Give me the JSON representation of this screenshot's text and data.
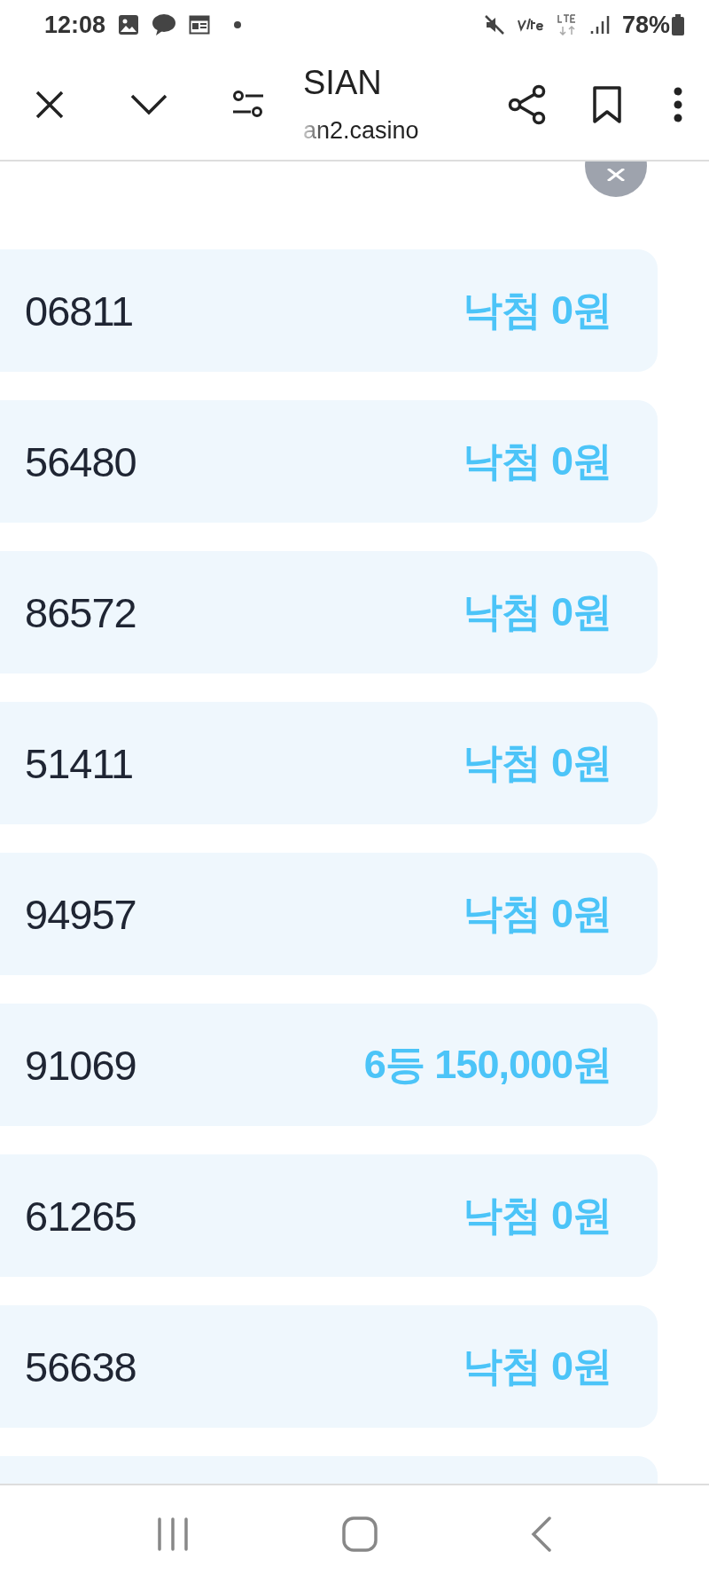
{
  "status_bar": {
    "time": "12:08",
    "battery": "78%"
  },
  "toolbar": {
    "title": "SIAN",
    "url": "an2.casino"
  },
  "rows": [
    {
      "number": "06811",
      "result": "낙첨 0원"
    },
    {
      "number": "56480",
      "result": "낙첨 0원"
    },
    {
      "number": "86572",
      "result": "낙첨 0원"
    },
    {
      "number": "51411",
      "result": "낙첨 0원"
    },
    {
      "number": "94957",
      "result": "낙첨 0원"
    },
    {
      "number": "91069",
      "result": "6등 150,000원"
    },
    {
      "number": "61265",
      "result": "낙첨 0원"
    },
    {
      "number": "56638",
      "result": "낙첨 0원"
    }
  ]
}
